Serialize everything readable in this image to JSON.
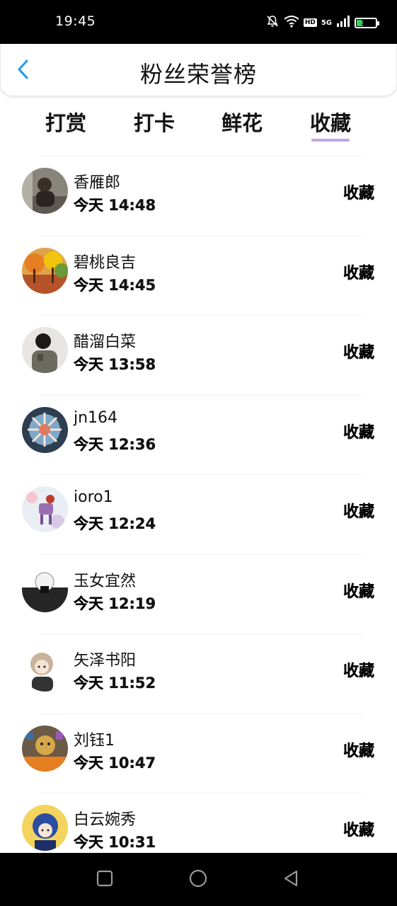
{
  "status_bar": {
    "time": "19:45",
    "battery": "34",
    "battery_level": 0.34,
    "network": "5G",
    "hd_badge": "HD",
    "icons": [
      "mute-bell-icon",
      "wifi-icon",
      "hd-icon",
      "signal-icon",
      "battery-icon"
    ]
  },
  "header": {
    "title": "粉丝荣誉榜",
    "back_icon": "chevron-left-icon",
    "accent_color": "#2196f3"
  },
  "tabs": [
    {
      "label": "打赏",
      "active": false
    },
    {
      "label": "打卡",
      "active": false
    },
    {
      "label": "鲜花",
      "active": false
    },
    {
      "label": "收藏",
      "active": true
    }
  ],
  "tab_underline_color": "#c5a4e6",
  "fans": [
    {
      "name": "香雁郎",
      "time": "今天 14:48",
      "action": "收藏"
    },
    {
      "name": "碧桃良吉",
      "time": "今天 14:45",
      "action": "收藏"
    },
    {
      "name": "醋溜白菜",
      "time": "今天 13:58",
      "action": "收藏"
    },
    {
      "name": "jn164",
      "time": "今天 12:36",
      "action": "收藏"
    },
    {
      "name": "ioro1",
      "time": "今天 12:24",
      "action": "收藏"
    },
    {
      "name": "玉女宜然",
      "time": "今天 12:19",
      "action": "收藏"
    },
    {
      "name": "矢泽书阳",
      "time": "今天 11:52",
      "action": "收藏"
    },
    {
      "name": "刘钰1",
      "time": "今天 10:47",
      "action": "收藏"
    },
    {
      "name": "白云婉秀",
      "time": "今天 10:31",
      "action": "收藏"
    }
  ],
  "nav_bar": {
    "icons": [
      "square-recents-icon",
      "circle-home-icon",
      "triangle-back-icon"
    ]
  }
}
